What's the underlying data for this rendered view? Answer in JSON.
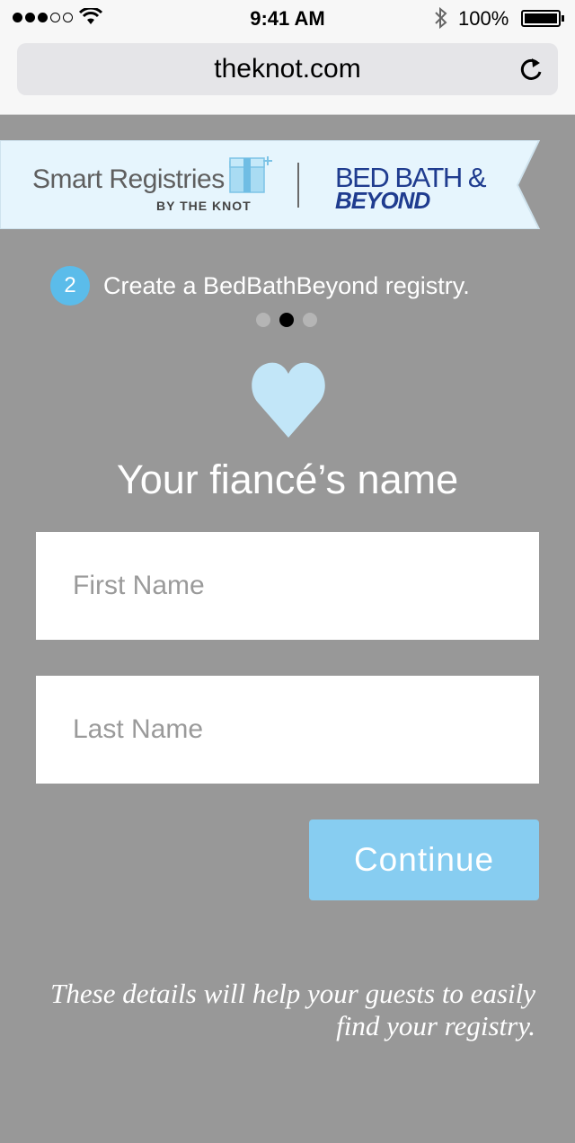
{
  "status_bar": {
    "time": "9:41 AM",
    "battery": "100%",
    "signal_bars": 3,
    "signal_total": 5
  },
  "browser": {
    "url": "theknot.com"
  },
  "banner": {
    "brand_name": "Smart Registries",
    "brand_sub": "BY THE KNOT",
    "partner_line1": "BED BATH &",
    "partner_line2": "BEYOND",
    "colors": {
      "partner": "#1f3c8f",
      "banner_bg": "#e6f5fd"
    }
  },
  "step": {
    "number": "2",
    "text": "Create a BedBathBeyond registry.",
    "current_page": 2,
    "total_pages": 3
  },
  "form": {
    "title": "Your fiancé’s name",
    "first_name_placeholder": "First Name",
    "last_name_placeholder": "Last Name",
    "continue_label": "Continue"
  },
  "note": "These details will help your guests to easily find your registry.",
  "colors": {
    "background": "#989898",
    "accent": "#87cdf1",
    "step_badge": "#5bbcea",
    "heart": "#c2e6f8"
  }
}
